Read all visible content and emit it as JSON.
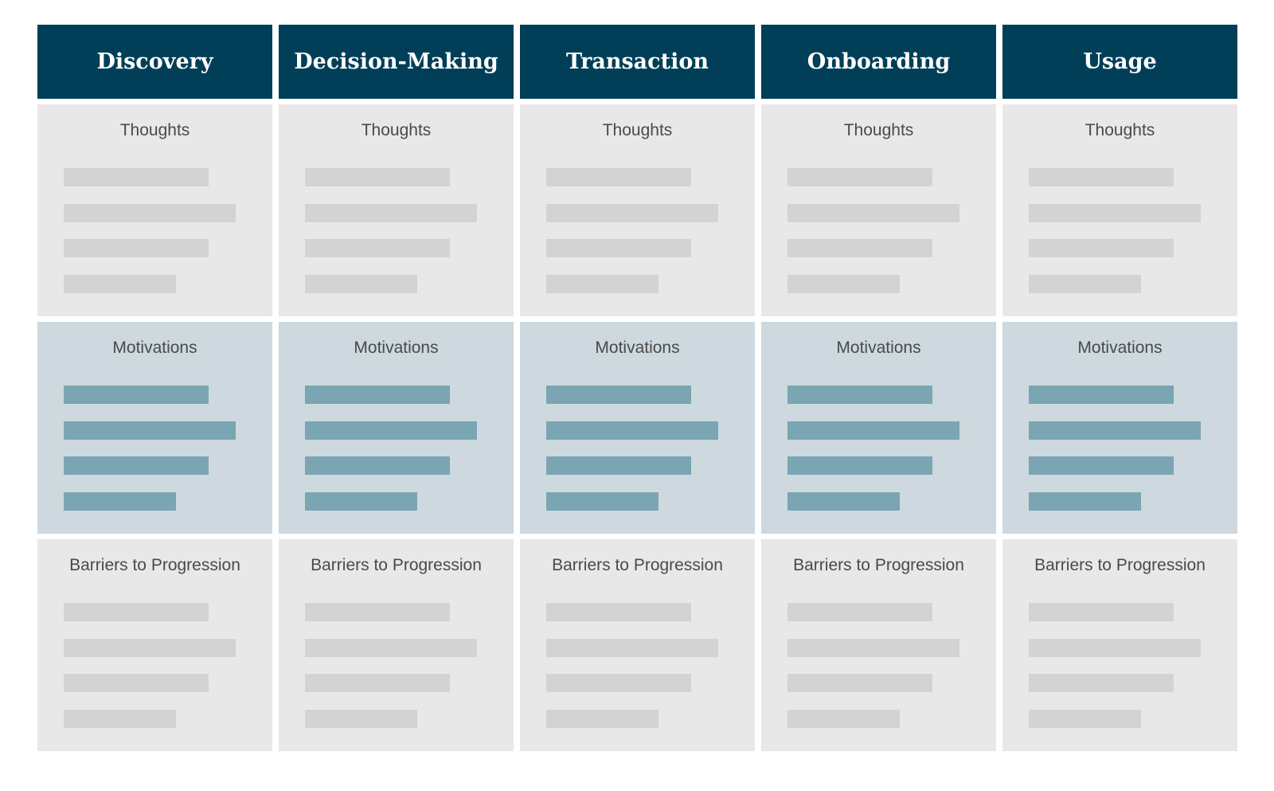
{
  "stages": [
    "Discovery",
    "Decision-Making",
    "Transaction",
    "Onboarding",
    "Usage"
  ],
  "sections": [
    {
      "label": "Thoughts",
      "tone": "gray"
    },
    {
      "label": "Motivations",
      "tone": "blue"
    },
    {
      "label": "Barriers to Progression",
      "tone": "gray"
    }
  ],
  "colors": {
    "header": "#003f57",
    "gray_cell": "#e8e8e8",
    "gray_bar": "#d3d3d3",
    "blue_cell": "#cdd9de",
    "blue_bar": "#7aa5b3"
  }
}
